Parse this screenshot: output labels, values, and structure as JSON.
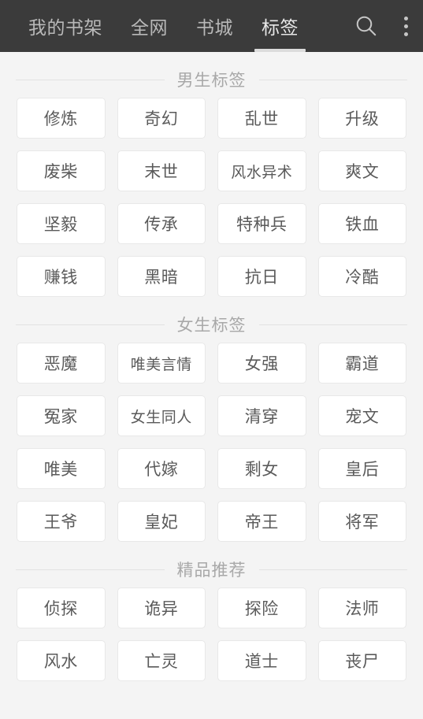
{
  "appbar": {
    "background_color": "#3b3b3b",
    "tabs": [
      {
        "label": "我的书架",
        "active": false
      },
      {
        "label": "全网",
        "active": false
      },
      {
        "label": "书城",
        "active": false
      },
      {
        "label": "标签",
        "active": true
      }
    ],
    "actions": [
      {
        "name": "search-icon",
        "label": "搜索"
      },
      {
        "name": "overflow-menu-icon",
        "label": "更多"
      }
    ],
    "active_indicator_color": "#dcdcdc"
  },
  "page": {
    "background_color": "#f4f4f4",
    "tag_background_color": "#ffffff",
    "tag_text_color": "#5a5a5a",
    "section_title_color": "#a8a8a8"
  },
  "sections": [
    {
      "title": "男生标签",
      "tags": [
        "修炼",
        "奇幻",
        "乱世",
        "升级",
        "废柴",
        "末世",
        "风水异术",
        "爽文",
        "坚毅",
        "传承",
        "特种兵",
        "铁血",
        "赚钱",
        "黑暗",
        "抗日",
        "冷酷"
      ]
    },
    {
      "title": "女生标签",
      "tags": [
        "恶魔",
        "唯美言情",
        "女强",
        "霸道",
        "冤家",
        "女生同人",
        "清穿",
        "宠文",
        "唯美",
        "代嫁",
        "剩女",
        "皇后",
        "王爷",
        "皇妃",
        "帝王",
        "将军"
      ]
    },
    {
      "title": "精品推荐",
      "tags": [
        "侦探",
        "诡异",
        "探险",
        "法师",
        "风水",
        "亡灵",
        "道士",
        "丧尸"
      ]
    }
  ]
}
